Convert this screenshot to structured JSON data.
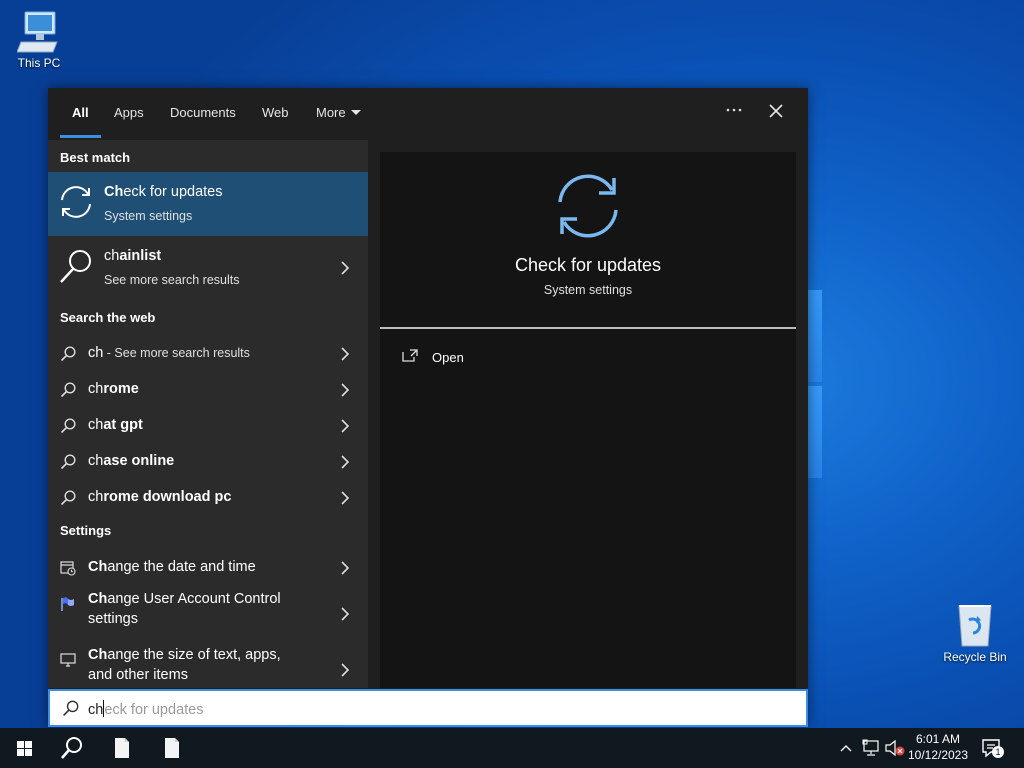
{
  "desktop": {
    "this_pc_label": "This PC",
    "recycle_bin_label": "Recycle Bin"
  },
  "search_panel": {
    "tabs": [
      {
        "label": "All",
        "active": true
      },
      {
        "label": "Apps"
      },
      {
        "label": "Documents"
      },
      {
        "label": "Web"
      },
      {
        "label": "More"
      }
    ],
    "options_icon": "more-options-icon",
    "close_icon": "close-icon",
    "best_match": {
      "heading": "Best match",
      "item": {
        "title_bold": "Ch",
        "title_rest": "eck for updates",
        "subtitle": "System settings",
        "icon": "sync-icon"
      }
    },
    "chainlist": {
      "title_bold": "ch",
      "title_rest": "ainlist",
      "subtitle": "See more search results",
      "icon": "search-icon"
    },
    "web": {
      "heading": "Search the web",
      "items": [
        {
          "bold": "ch",
          "rest": "",
          "hint": " - See more search results"
        },
        {
          "bold": "",
          "pre": "ch",
          "rest": "rome"
        },
        {
          "pre": "ch",
          "rest": "at gpt"
        },
        {
          "pre": "ch",
          "rest": "ase online"
        },
        {
          "pre": "ch",
          "rest": "rome download pc"
        }
      ]
    },
    "settings": {
      "heading": "Settings",
      "items": [
        {
          "bold": "Ch",
          "rest": "ange the date and time",
          "icon": "calendar-clock-icon"
        },
        {
          "bold": "Ch",
          "rest": "ange User Account Control",
          "rest2": "settings",
          "icon": "uac-flag-icon"
        },
        {
          "bold": "Ch",
          "rest": "ange the size of text, apps,",
          "rest2": "and other items",
          "icon": "display-icon"
        }
      ]
    },
    "preview": {
      "title": "Check for updates",
      "subtitle": "System settings",
      "action_open": "Open",
      "icon": "sync-icon",
      "accent": "#7ab8f0"
    },
    "search_box": {
      "typed": "ch",
      "suggestion_rest": "eck for updates"
    }
  },
  "taskbar": {
    "time": "6:01 AM",
    "date": "10/12/2023",
    "notification_count": "1",
    "colors": {
      "bg": "#101820",
      "accent": "#3a8ee6"
    }
  }
}
